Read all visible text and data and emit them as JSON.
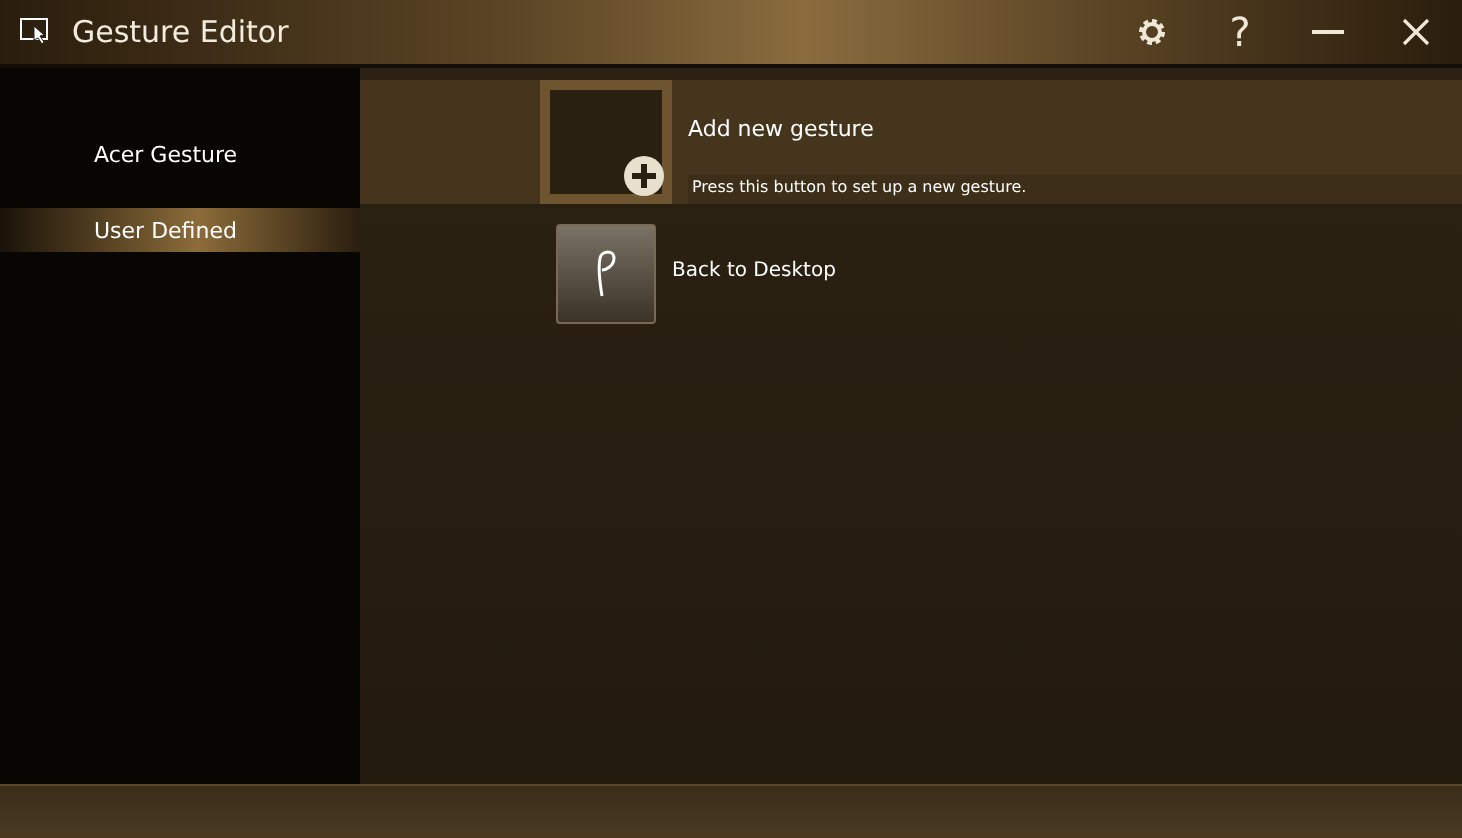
{
  "window": {
    "title": "Gesture Editor"
  },
  "title_buttons": [
    {
      "kind": "settings"
    },
    {
      "kind": "help",
      "label": "?"
    },
    {
      "kind": "minimize"
    },
    {
      "kind": "close"
    }
  ],
  "sidebar": {
    "items": [
      {
        "label": "Acer Gesture",
        "selected": false
      },
      {
        "label": "User Defined",
        "selected": true
      }
    ]
  },
  "gestures": [
    {
      "kind": "add",
      "label": "Add new gesture",
      "hint": "Press this button to set up a new gesture.",
      "selected": true
    },
    {
      "kind": "gesture",
      "label": "Back to Desktop",
      "selected": false
    }
  ]
}
